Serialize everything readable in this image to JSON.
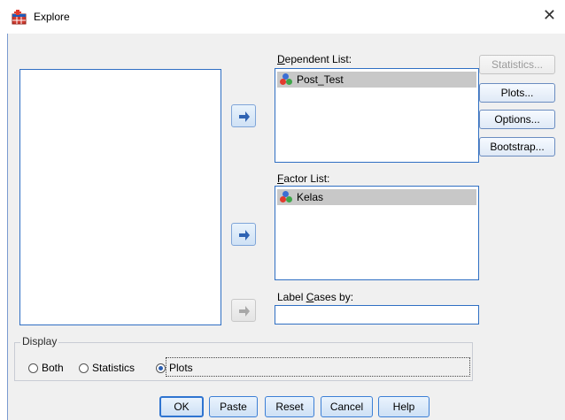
{
  "window": {
    "title": "Explore",
    "close_glyph": "✕"
  },
  "dependent_list": {
    "label": "Dependent List:",
    "label_mnemonic": "D",
    "label_rest": "ependent List:",
    "items": [
      "Post_Test"
    ]
  },
  "factor_list": {
    "label": "Factor List:",
    "label_mnemonic": "F",
    "label_rest": "actor List:",
    "items": [
      "Kelas"
    ]
  },
  "label_cases": {
    "label": "Label Cases by:",
    "label_pre": "Label ",
    "label_mnemonic": "C",
    "label_rest": "ases by:",
    "value": ""
  },
  "side_buttons": {
    "statistics": "Statistics...",
    "plots": "Plots...",
    "options": "Options...",
    "bootstrap": "Bootstrap..."
  },
  "display": {
    "title": "Display",
    "options": [
      {
        "label": "Both",
        "checked": false
      },
      {
        "label": "Statistics",
        "checked": false
      },
      {
        "label": "Plots",
        "checked": true
      }
    ]
  },
  "bottom_buttons": {
    "ok": "OK",
    "paste": "Paste",
    "reset": "Reset",
    "cancel": "Cancel",
    "help": "Help"
  },
  "colors": {
    "accent_border": "#2f6fc3",
    "selected_item_bg": "#c8c8c8",
    "dialog_bg": "#f0f0f0"
  }
}
